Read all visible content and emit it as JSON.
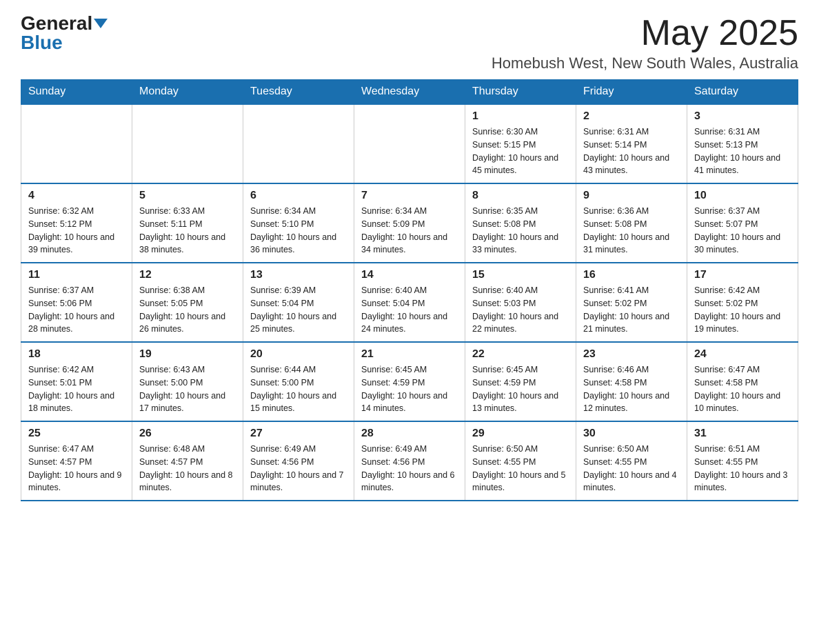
{
  "logo": {
    "general": "General",
    "blue": "Blue"
  },
  "header": {
    "month_year": "May 2025",
    "location": "Homebush West, New South Wales, Australia"
  },
  "days_of_week": [
    "Sunday",
    "Monday",
    "Tuesday",
    "Wednesday",
    "Thursday",
    "Friday",
    "Saturday"
  ],
  "weeks": [
    [
      {
        "day": "",
        "info": ""
      },
      {
        "day": "",
        "info": ""
      },
      {
        "day": "",
        "info": ""
      },
      {
        "day": "",
        "info": ""
      },
      {
        "day": "1",
        "info": "Sunrise: 6:30 AM\nSunset: 5:15 PM\nDaylight: 10 hours and 45 minutes."
      },
      {
        "day": "2",
        "info": "Sunrise: 6:31 AM\nSunset: 5:14 PM\nDaylight: 10 hours and 43 minutes."
      },
      {
        "day": "3",
        "info": "Sunrise: 6:31 AM\nSunset: 5:13 PM\nDaylight: 10 hours and 41 minutes."
      }
    ],
    [
      {
        "day": "4",
        "info": "Sunrise: 6:32 AM\nSunset: 5:12 PM\nDaylight: 10 hours and 39 minutes."
      },
      {
        "day": "5",
        "info": "Sunrise: 6:33 AM\nSunset: 5:11 PM\nDaylight: 10 hours and 38 minutes."
      },
      {
        "day": "6",
        "info": "Sunrise: 6:34 AM\nSunset: 5:10 PM\nDaylight: 10 hours and 36 minutes."
      },
      {
        "day": "7",
        "info": "Sunrise: 6:34 AM\nSunset: 5:09 PM\nDaylight: 10 hours and 34 minutes."
      },
      {
        "day": "8",
        "info": "Sunrise: 6:35 AM\nSunset: 5:08 PM\nDaylight: 10 hours and 33 minutes."
      },
      {
        "day": "9",
        "info": "Sunrise: 6:36 AM\nSunset: 5:08 PM\nDaylight: 10 hours and 31 minutes."
      },
      {
        "day": "10",
        "info": "Sunrise: 6:37 AM\nSunset: 5:07 PM\nDaylight: 10 hours and 30 minutes."
      }
    ],
    [
      {
        "day": "11",
        "info": "Sunrise: 6:37 AM\nSunset: 5:06 PM\nDaylight: 10 hours and 28 minutes."
      },
      {
        "day": "12",
        "info": "Sunrise: 6:38 AM\nSunset: 5:05 PM\nDaylight: 10 hours and 26 minutes."
      },
      {
        "day": "13",
        "info": "Sunrise: 6:39 AM\nSunset: 5:04 PM\nDaylight: 10 hours and 25 minutes."
      },
      {
        "day": "14",
        "info": "Sunrise: 6:40 AM\nSunset: 5:04 PM\nDaylight: 10 hours and 24 minutes."
      },
      {
        "day": "15",
        "info": "Sunrise: 6:40 AM\nSunset: 5:03 PM\nDaylight: 10 hours and 22 minutes."
      },
      {
        "day": "16",
        "info": "Sunrise: 6:41 AM\nSunset: 5:02 PM\nDaylight: 10 hours and 21 minutes."
      },
      {
        "day": "17",
        "info": "Sunrise: 6:42 AM\nSunset: 5:02 PM\nDaylight: 10 hours and 19 minutes."
      }
    ],
    [
      {
        "day": "18",
        "info": "Sunrise: 6:42 AM\nSunset: 5:01 PM\nDaylight: 10 hours and 18 minutes."
      },
      {
        "day": "19",
        "info": "Sunrise: 6:43 AM\nSunset: 5:00 PM\nDaylight: 10 hours and 17 minutes."
      },
      {
        "day": "20",
        "info": "Sunrise: 6:44 AM\nSunset: 5:00 PM\nDaylight: 10 hours and 15 minutes."
      },
      {
        "day": "21",
        "info": "Sunrise: 6:45 AM\nSunset: 4:59 PM\nDaylight: 10 hours and 14 minutes."
      },
      {
        "day": "22",
        "info": "Sunrise: 6:45 AM\nSunset: 4:59 PM\nDaylight: 10 hours and 13 minutes."
      },
      {
        "day": "23",
        "info": "Sunrise: 6:46 AM\nSunset: 4:58 PM\nDaylight: 10 hours and 12 minutes."
      },
      {
        "day": "24",
        "info": "Sunrise: 6:47 AM\nSunset: 4:58 PM\nDaylight: 10 hours and 10 minutes."
      }
    ],
    [
      {
        "day": "25",
        "info": "Sunrise: 6:47 AM\nSunset: 4:57 PM\nDaylight: 10 hours and 9 minutes."
      },
      {
        "day": "26",
        "info": "Sunrise: 6:48 AM\nSunset: 4:57 PM\nDaylight: 10 hours and 8 minutes."
      },
      {
        "day": "27",
        "info": "Sunrise: 6:49 AM\nSunset: 4:56 PM\nDaylight: 10 hours and 7 minutes."
      },
      {
        "day": "28",
        "info": "Sunrise: 6:49 AM\nSunset: 4:56 PM\nDaylight: 10 hours and 6 minutes."
      },
      {
        "day": "29",
        "info": "Sunrise: 6:50 AM\nSunset: 4:55 PM\nDaylight: 10 hours and 5 minutes."
      },
      {
        "day": "30",
        "info": "Sunrise: 6:50 AM\nSunset: 4:55 PM\nDaylight: 10 hours and 4 minutes."
      },
      {
        "day": "31",
        "info": "Sunrise: 6:51 AM\nSunset: 4:55 PM\nDaylight: 10 hours and 3 minutes."
      }
    ]
  ]
}
